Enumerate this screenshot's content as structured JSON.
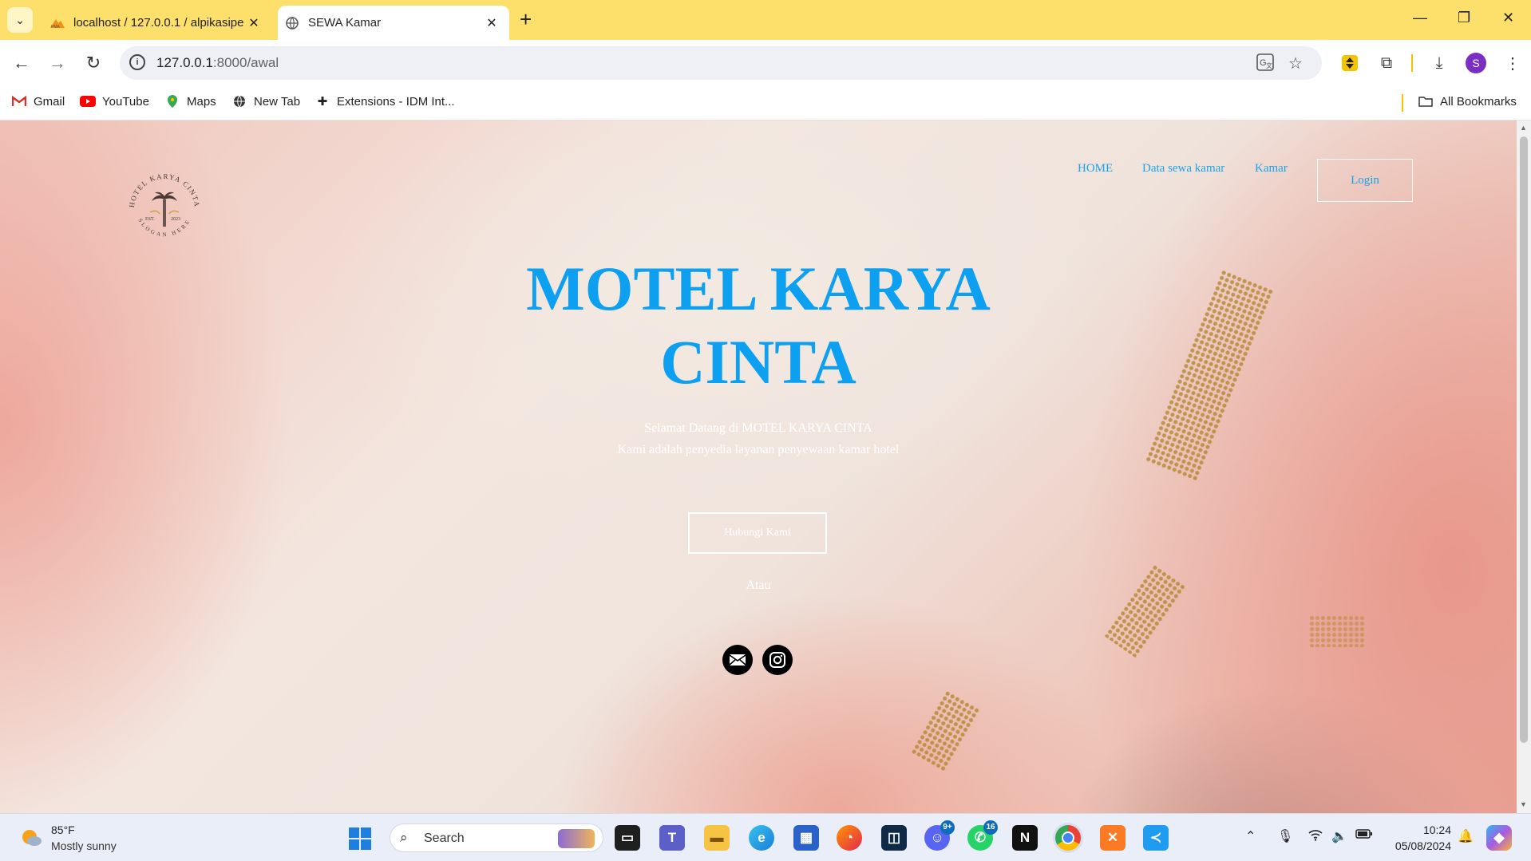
{
  "browser": {
    "tabs": [
      {
        "title": "localhost / 127.0.0.1 / alpikasipe",
        "active": false
      },
      {
        "title": "SEWA Kamar",
        "active": true
      }
    ],
    "url_host": "127.0.0.1",
    "url_path": ":8000/awal",
    "bookmarks": [
      {
        "label": "Gmail",
        "icon": "gmail-icon"
      },
      {
        "label": "YouTube",
        "icon": "youtube-icon"
      },
      {
        "label": "Maps",
        "icon": "maps-icon"
      },
      {
        "label": "New Tab",
        "icon": "globe-icon"
      },
      {
        "label": "Extensions - IDM Int...",
        "icon": "puzzle-icon"
      }
    ],
    "all_bookmarks": "All Bookmarks",
    "profile_initial": "S"
  },
  "page": {
    "logo_text_top": "HOTEL KARYA CINTA",
    "logo_est": "EST.",
    "logo_year": "2023",
    "logo_slogan": "SLOGAN HERE",
    "nav": [
      {
        "label": "HOME"
      },
      {
        "label": "Data sewa kamar"
      },
      {
        "label": "Kamar"
      }
    ],
    "login": "Login",
    "title_line1": "MOTEL KARYA",
    "title_line2": "CINTA",
    "welcome": "Selamat Datang di MOTEL KARYA CINTA",
    "tagline": "Kami adalah penyedia layanan penyewaan kamar hotel",
    "contact_button": "Hubungi Kami",
    "or_text": "Atau",
    "colors": {
      "title": "#0d9ff0",
      "nav": "#1aa3e8",
      "text": "#ffffff"
    }
  },
  "taskbar": {
    "weather_temp": "85°F",
    "weather_desc": "Mostly sunny",
    "search_label": "Search",
    "discord_badge": "9+",
    "whatsapp_badge": "16",
    "time": "10:24",
    "date": "05/08/2024"
  }
}
